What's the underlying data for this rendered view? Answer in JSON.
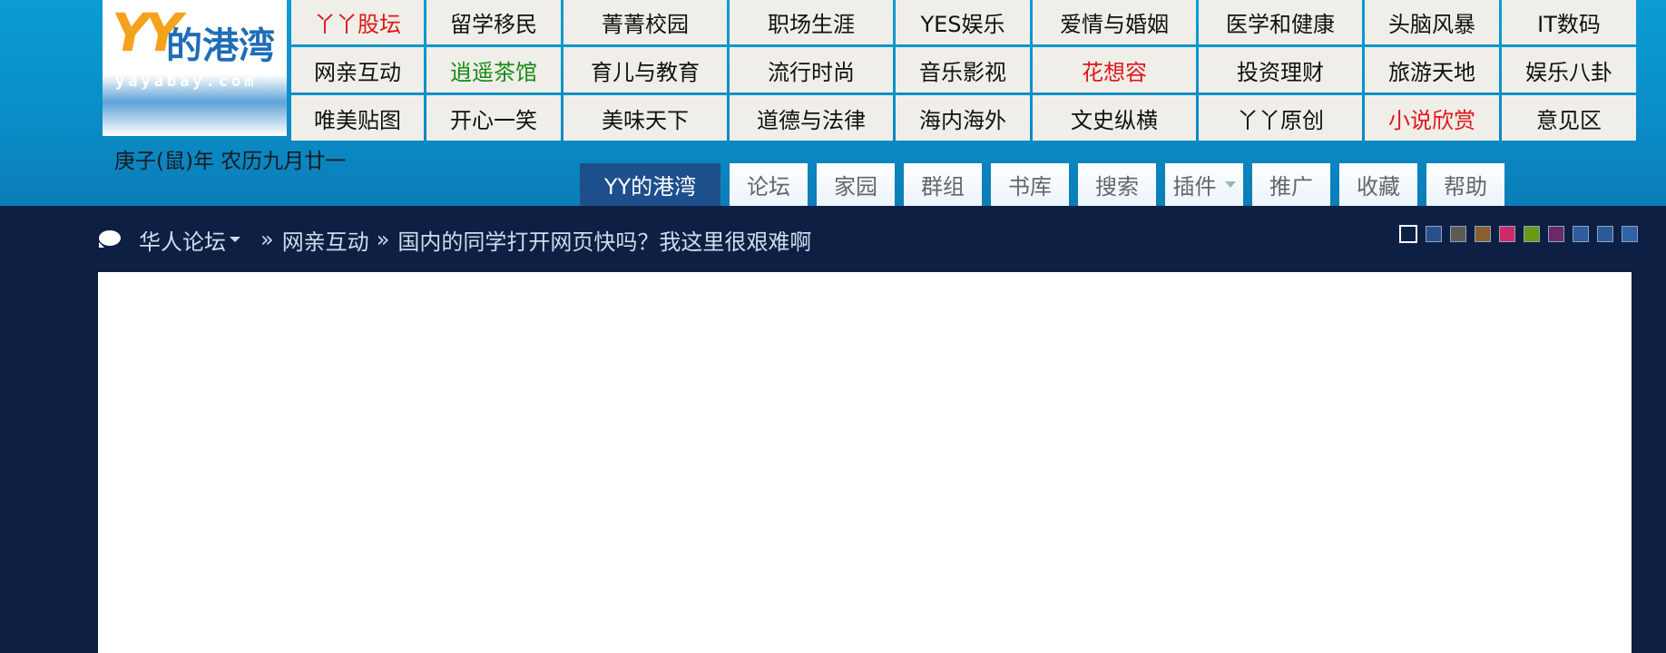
{
  "logo": {
    "mark": "YY",
    "name": "的港湾",
    "url": "yayabay.com"
  },
  "nav": [
    {
      "label": "丫丫股坛",
      "color": "red"
    },
    {
      "label": "留学移民",
      "color": "normal"
    },
    {
      "label": "菁菁校园",
      "color": "normal"
    },
    {
      "label": "职场生涯",
      "color": "normal"
    },
    {
      "label": "YES娱乐",
      "color": "normal"
    },
    {
      "label": "爱情与婚姻",
      "color": "normal"
    },
    {
      "label": "医学和健康",
      "color": "normal"
    },
    {
      "label": "头脑风暴",
      "color": "normal"
    },
    {
      "label": "IT数码",
      "color": "normal"
    },
    {
      "label": "网亲互动",
      "color": "normal"
    },
    {
      "label": "逍遥茶馆",
      "color": "green"
    },
    {
      "label": "育儿与教育",
      "color": "normal"
    },
    {
      "label": "流行时尚",
      "color": "normal"
    },
    {
      "label": "音乐影视",
      "color": "normal"
    },
    {
      "label": "花想容",
      "color": "red"
    },
    {
      "label": "投资理财",
      "color": "normal"
    },
    {
      "label": "旅游天地",
      "color": "normal"
    },
    {
      "label": "娱乐八卦",
      "color": "normal"
    },
    {
      "label": "唯美贴图",
      "color": "normal"
    },
    {
      "label": "开心一笑",
      "color": "normal"
    },
    {
      "label": "美味天下",
      "color": "normal"
    },
    {
      "label": "道德与法律",
      "color": "normal"
    },
    {
      "label": "海内海外",
      "color": "normal"
    },
    {
      "label": "文史纵横",
      "color": "normal"
    },
    {
      "label": "丫丫原创",
      "color": "normal"
    },
    {
      "label": "小说欣赏",
      "color": "red"
    },
    {
      "label": "意见区",
      "color": "normal"
    }
  ],
  "date": "庚子(鼠)年 农历九月廿一",
  "tabs": [
    {
      "label": "YY的港湾",
      "active": true
    },
    {
      "label": "论坛"
    },
    {
      "label": "家园"
    },
    {
      "label": "群组"
    },
    {
      "label": "书库"
    },
    {
      "label": "搜索"
    },
    {
      "label": "插件",
      "dropdown": true
    },
    {
      "label": "推广"
    },
    {
      "label": "收藏"
    },
    {
      "label": "帮助"
    }
  ],
  "breadcrumb": {
    "root": "华人论坛",
    "separator": "»",
    "forum": "网亲互动",
    "thread": "国内的同学打开网页快吗？我这里很艰难啊"
  },
  "colors": {
    "header": "#0a9dd3",
    "page_bg": "#0d1f42",
    "nav_cell": "#efeee8",
    "active_tab": "#1d4f8c",
    "red_link": "#e0161a",
    "green_link": "#188a15"
  },
  "swatches": [
    "#0d1f42",
    "#2a4f8a",
    "#5c5a52",
    "#8a6032",
    "#cc2a6a",
    "#6a9a12",
    "#6a2a6a",
    "#2e5c9c",
    "#2c5a98",
    "#2f62a6"
  ]
}
